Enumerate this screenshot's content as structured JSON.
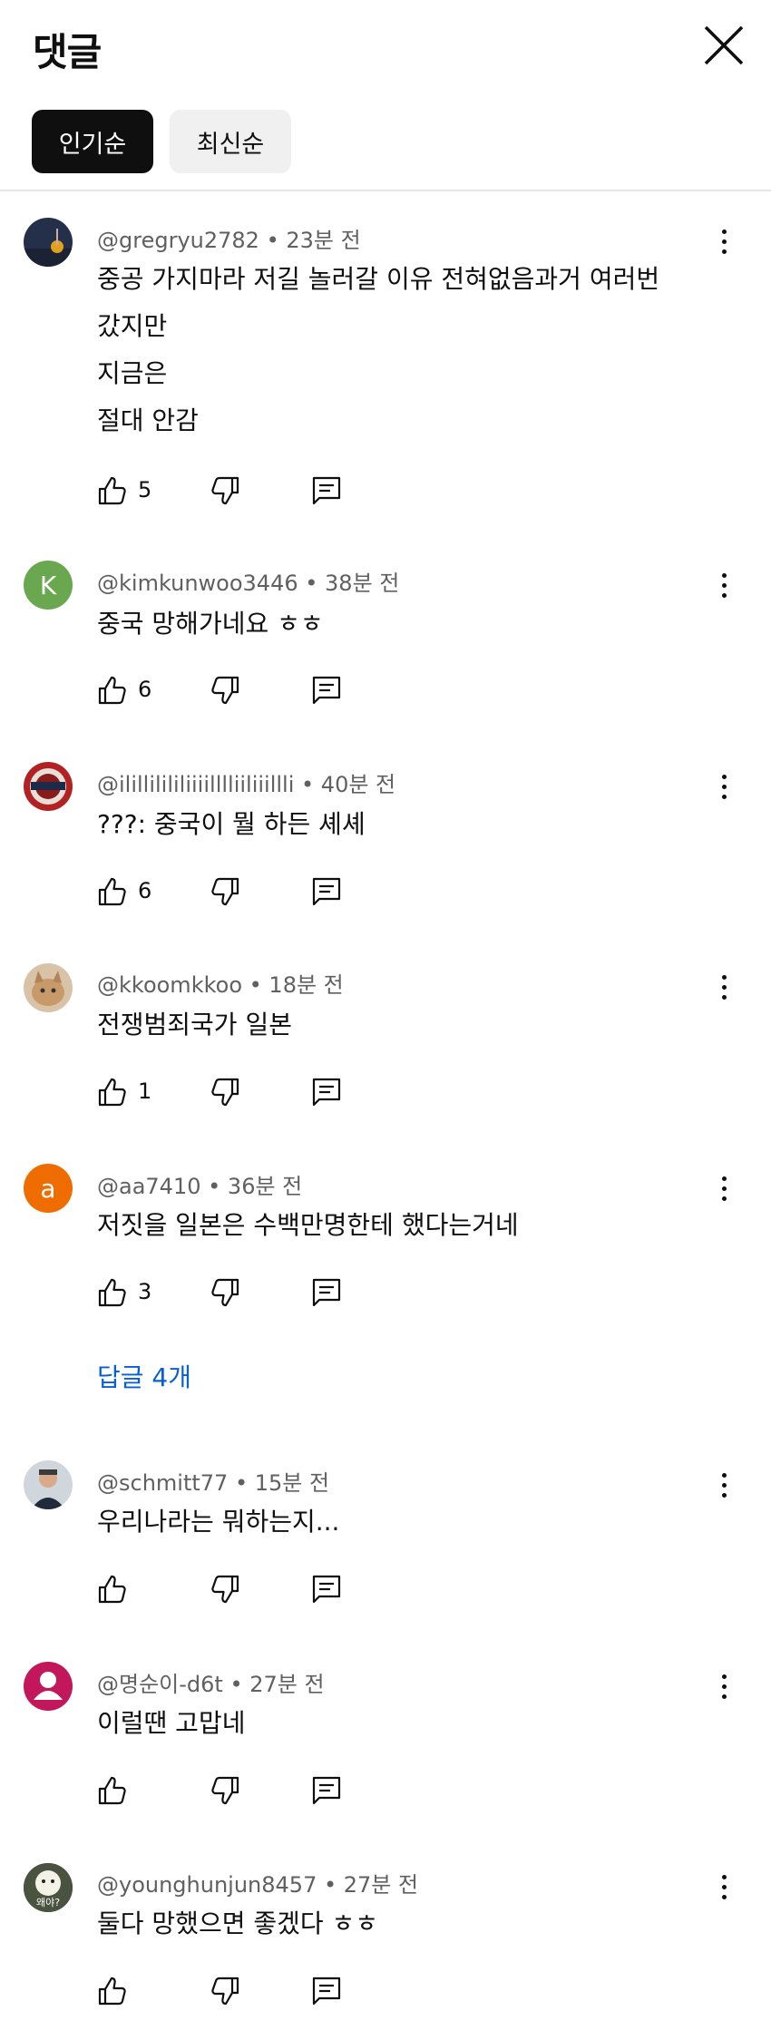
{
  "header": {
    "title": "댓글"
  },
  "tabs": [
    {
      "label": "인기순",
      "active": true
    },
    {
      "label": "최신순",
      "active": false
    }
  ],
  "comments": [
    {
      "author": "@gregryu2782",
      "time": "23분 전",
      "lines": [
        "중공 가지마라 저길 놀러갈 이유 전혀없음과거 여러번",
        "갔지만",
        "지금은",
        "절대 안감"
      ],
      "likes": "5",
      "avatar": "photo-dark"
    },
    {
      "author": "@kimkunwoo3446",
      "time": "38분 전",
      "lines": [
        "중국 망해가네요 ㅎㅎ"
      ],
      "likes": "6",
      "avatar_letter": "K",
      "avatar_color": "#6aa84f"
    },
    {
      "author": "@ilillilililiiiilllliiliiillli",
      "time": "40분 전",
      "lines": [
        "???: 중국이 뭘 하든 셰셰"
      ],
      "likes": "6",
      "avatar": "photo-badge"
    },
    {
      "author": "@kkoomkkoo",
      "time": "18분 전",
      "lines": [
        "전쟁범죄국가 일본"
      ],
      "likes": "1",
      "avatar": "photo-cat"
    },
    {
      "author": "@aa7410",
      "time": "36분 전",
      "lines": [
        "저짓을 일본은 수백만명한테 했다는거네"
      ],
      "likes": "3",
      "avatar_letter": "a",
      "avatar_color": "#ef6c00"
    },
    {
      "author": "@schmitt77",
      "time": "15분 전",
      "lines": [
        "우리나라는 뭐하는지..."
      ],
      "likes": "",
      "avatar": "photo-person"
    },
    {
      "author": "@명순이-d6t",
      "time": "27분 전",
      "lines": [
        "이럴땐 고맙네"
      ],
      "likes": "",
      "avatar": "default-profile"
    },
    {
      "author": "@younghunjun8457",
      "time": "27분 전",
      "lines": [
        "둘다 망했으면 좋겠다 ㅎㅎ"
      ],
      "likes": "",
      "avatar": "photo-cartoon",
      "avatar_text": "왜야?"
    }
  ],
  "replies_link": "답글 4개",
  "colors": {
    "link": "#065fd4",
    "meta": "#606060",
    "chip_active": "#0f0f0f",
    "chip_inactive": "#f0f0f0"
  }
}
